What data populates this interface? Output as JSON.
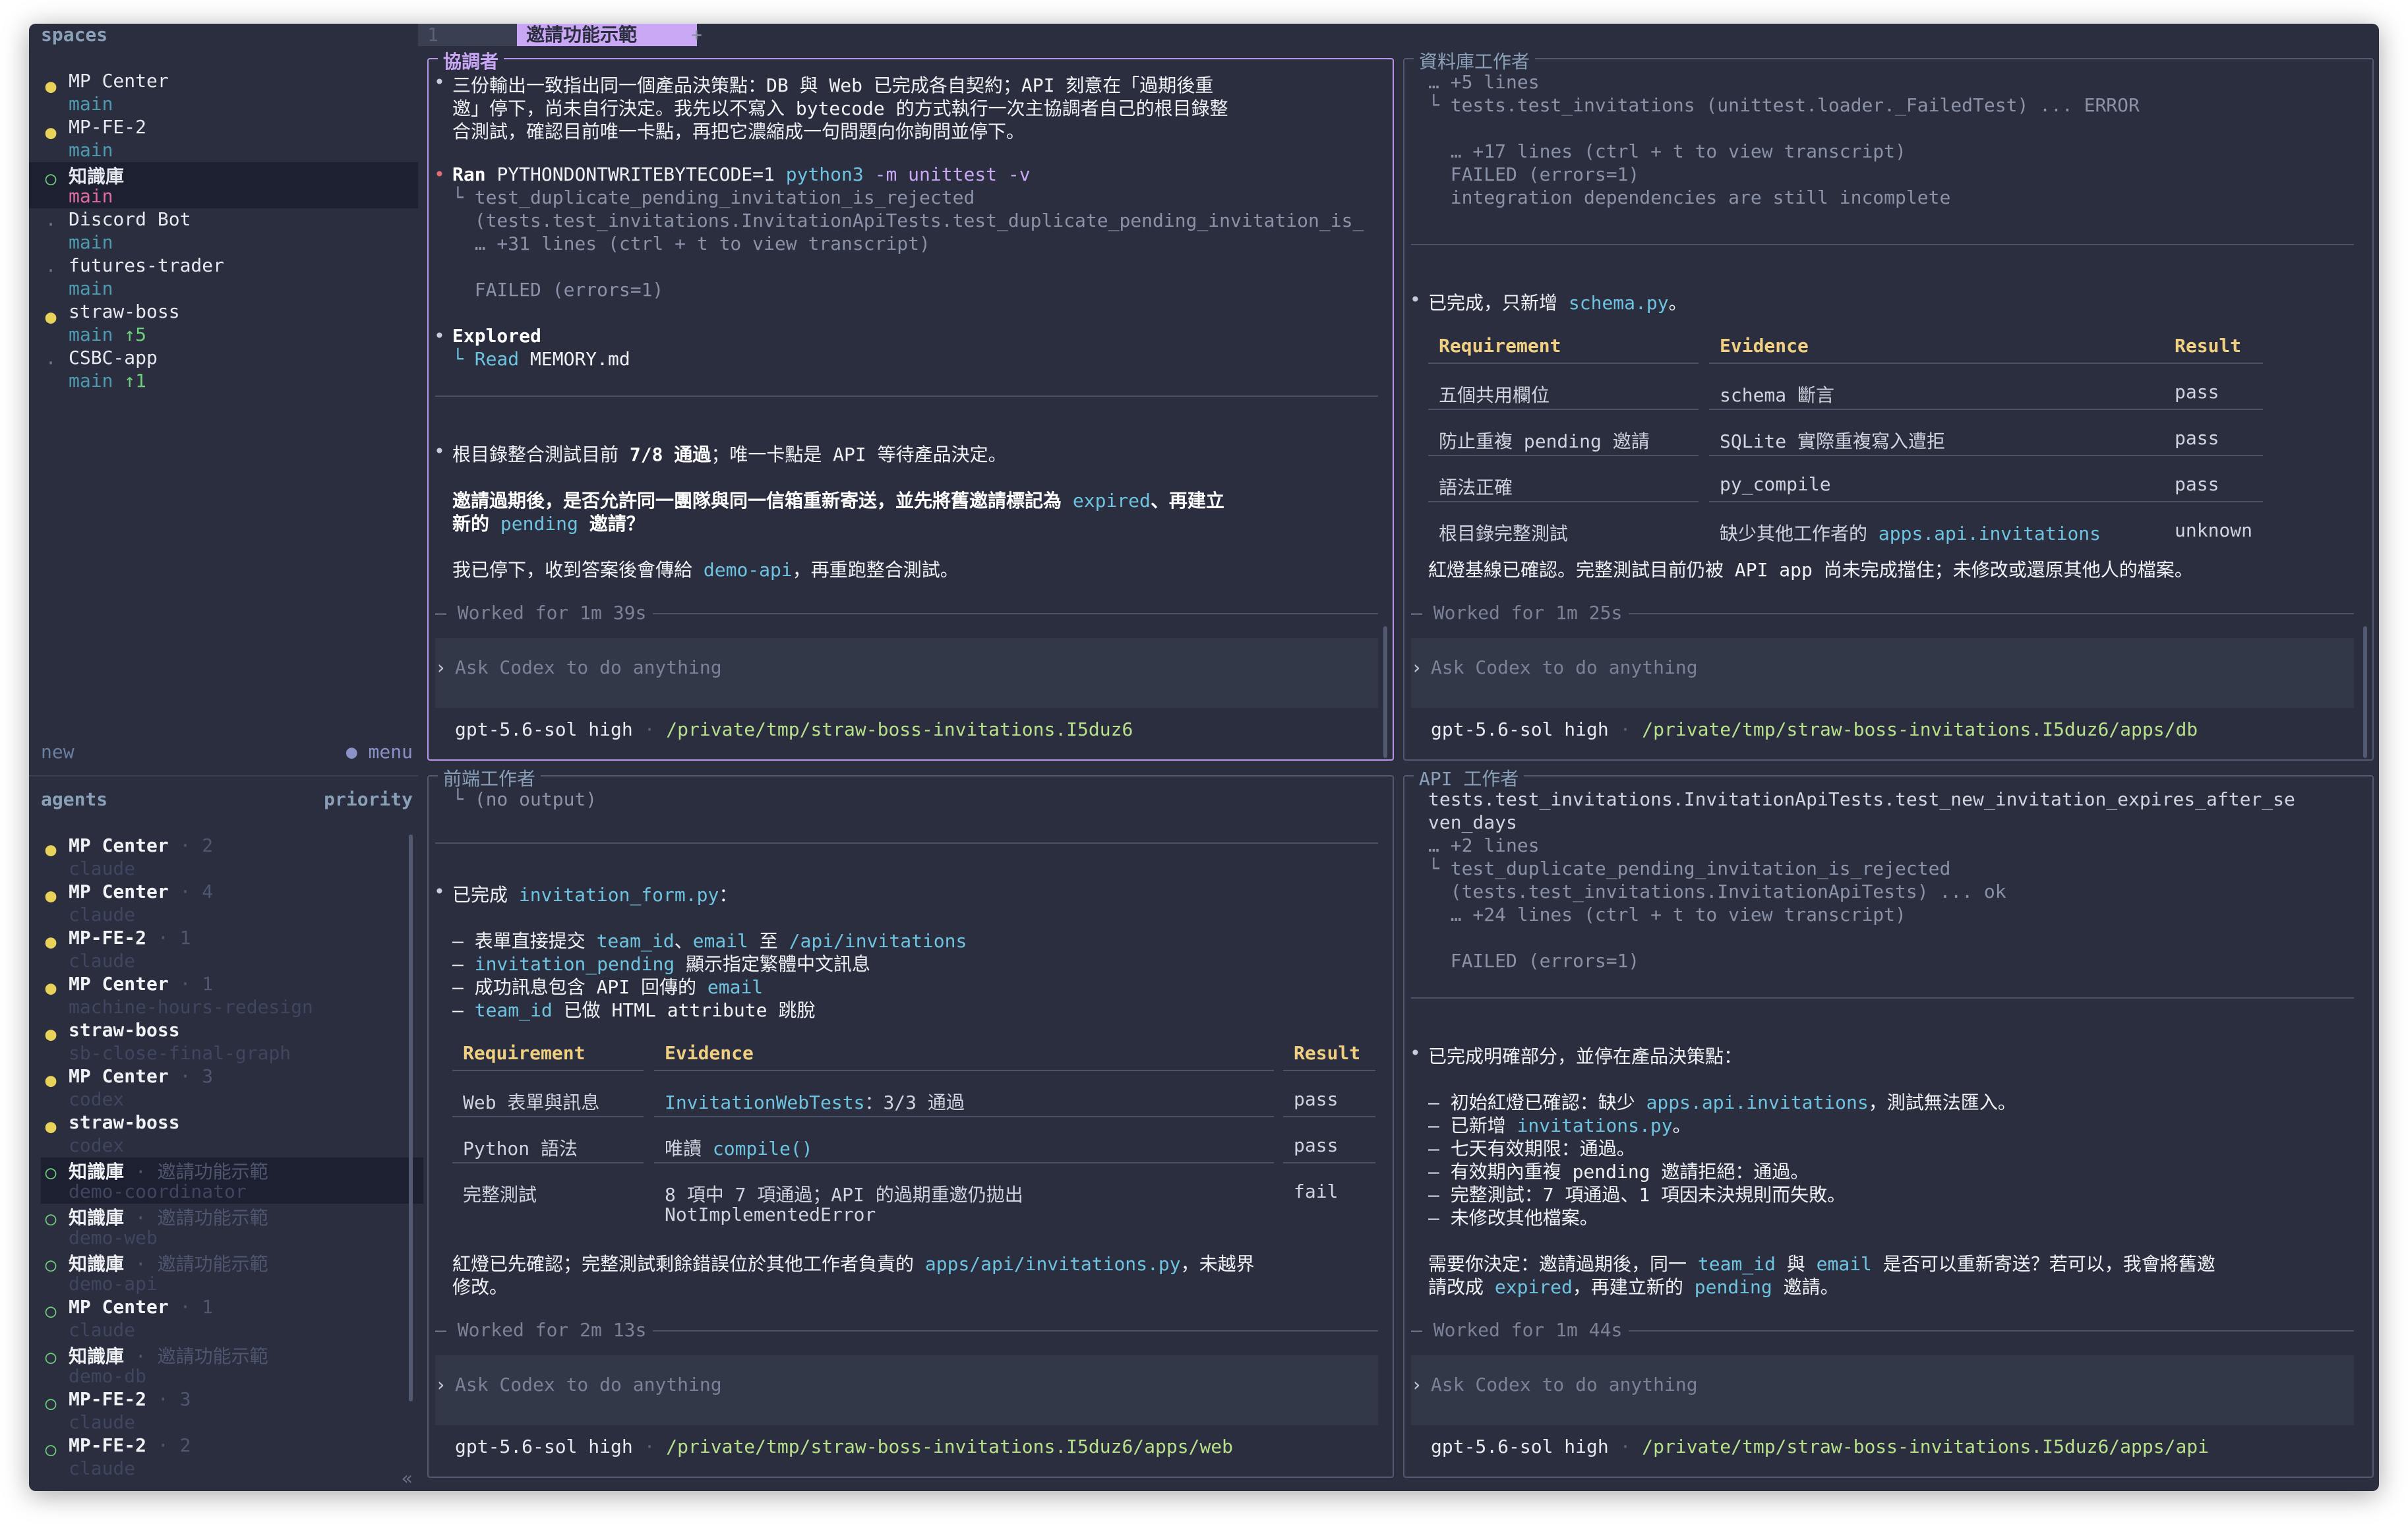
{
  "sidebar": {
    "spaces_label": "spaces",
    "spaces": [
      {
        "name": "MP Center",
        "branch": "main",
        "dot": "●",
        "dot_color": "yellow"
      },
      {
        "name": "MP-FE-2",
        "branch": "main",
        "dot": "●",
        "dot_color": "yellow"
      },
      {
        "name": "知識庫",
        "branch": "main",
        "dot": "○",
        "dot_color": "green",
        "selected": true
      },
      {
        "name": "Discord Bot",
        "branch": "main",
        "dot": "·",
        "dot_color": "grey"
      },
      {
        "name": "futures-trader",
        "branch": "main",
        "dot": "·",
        "dot_color": "grey"
      },
      {
        "name": "straw-boss",
        "branch": "main",
        "branch_extra": "↑5",
        "dot": "●",
        "dot_color": "yellow"
      },
      {
        "name": "CSBC-app",
        "branch": "main",
        "branch_extra": "↑1",
        "dot": "·",
        "dot_color": "grey"
      }
    ],
    "new_label": "new",
    "menu_label": "● menu",
    "agents_label": "agents",
    "priority_label": "priority",
    "collapse_label": "«",
    "agents": [
      {
        "name": "MP Center",
        "num": "· 2",
        "sub": "claude",
        "dot": "●",
        "dot_color": "yellow"
      },
      {
        "name": "MP Center",
        "num": "· 4",
        "sub": "claude",
        "dot": "●",
        "dot_color": "yellow"
      },
      {
        "name": "MP-FE-2",
        "num": "· 1",
        "sub": "claude",
        "dot": "●",
        "dot_color": "yellow"
      },
      {
        "name": "MP Center",
        "num": "· 1",
        "sub": "machine-hours-redesign",
        "dot": "●",
        "dot_color": "yellow"
      },
      {
        "name": "straw-boss",
        "num": "",
        "sub": "sb-close-final-graph",
        "dot": "●",
        "dot_color": "yellow"
      },
      {
        "name": "MP Center",
        "num": "· 3",
        "sub": "codex",
        "dot": "●",
        "dot_color": "yellow"
      },
      {
        "name": "straw-boss",
        "num": "",
        "sub": "codex",
        "dot": "●",
        "dot_color": "yellow"
      },
      {
        "name": "知識庫",
        "num": "· 邀請功能示範",
        "sub": "demo-coordinator",
        "dot": "○",
        "dot_color": "green",
        "selected": true
      },
      {
        "name": "知識庫",
        "num": "· 邀請功能示範",
        "sub": "demo-web",
        "dot": "○",
        "dot_color": "green"
      },
      {
        "name": "知識庫",
        "num": "· 邀請功能示範",
        "sub": "demo-api",
        "dot": "○",
        "dot_color": "green"
      },
      {
        "name": "MP Center",
        "num": "· 1",
        "sub": "claude",
        "dot": "○",
        "dot_color": "green"
      },
      {
        "name": "知識庫",
        "num": "· 邀請功能示範",
        "sub": "demo-db",
        "dot": "○",
        "dot_color": "green"
      },
      {
        "name": "MP-FE-2",
        "num": "· 3",
        "sub": "claude",
        "dot": "○",
        "dot_color": "green"
      },
      {
        "name": "MP-FE-2",
        "num": "· 2",
        "sub": "claude",
        "dot": "○",
        "dot_color": "green"
      }
    ]
  },
  "tabs": {
    "tab1": "1",
    "tab2": "邀請功能示範",
    "plus": "+"
  },
  "panes": {
    "coordinator": {
      "title": "協調者",
      "p1_l1": "三份輸出一致指出同一個產品決策點：DB 與 Web 已完成各自契約；API 刻意在「過期後重",
      "p1_l2": "邀」停下，尚未自行決定。我先以不寫入 bytecode 的方式執行一次主協調者自己的根目錄整",
      "p1_l3": "合測試，確認目前唯一卡點，再把它濃縮成一句問題向你詢問並停下。",
      "ran_label": "Ran",
      "ran_cmd": "PYTHONDONTWRITEBYTECODE=1",
      "ran_py": "python3",
      "ran_args": "-m unittest -v",
      "ran_o1": "└ test_duplicate_pending_invitation_is_rejected",
      "ran_o2": "  (tests.test_invitations.InvitationApiTests.test_duplicate_pending_invitation_is_",
      "ran_o3": "  … +31 lines (ctrl + t to view transcript)",
      "ran_o4": "  FAILED (errors=1)",
      "explored_label": "Explored",
      "explored_read": "└ Read",
      "explored_file": "MEMORY.md",
      "s_pre": "根目錄整合測試目前",
      "s_bold": "7/8 通過",
      "s_post": "；唯一卡點是 API 等待產品決定。",
      "q1a": "邀請過期後，是否允許同一團隊與同一信箱重新寄送，並先將舊邀請標記為",
      "q1b": "expired",
      "q1c": "、再建立",
      "q2a": "新的",
      "q2b": "pending",
      "q2c": "邀請？",
      "stop_a": "我已停下，收到答案後會傳給",
      "stop_b": "demo-api",
      "stop_c": "，再重跑整合測試。",
      "worked": "Worked for 1m 39s",
      "placeholder": "Ask Codex to do anything",
      "model": "gpt-5.6-sol high",
      "sep": "·",
      "path": "/private/tmp/straw-boss-invitations.I5duz6"
    },
    "db": {
      "title": "資料庫工作者",
      "l1": "… +5 lines",
      "l2": "└ tests.test_invitations (unittest.loader._FailedTest) ... ERROR",
      "l3": "  … +17 lines (ctrl + t to view transcript)",
      "l4": "  FAILED (errors=1)",
      "l5": "  integration dependencies are still incomplete",
      "done_a": "已完成，只新增",
      "done_b": "schema.py",
      "done_c": "。",
      "table_headers": [
        "Requirement",
        "Evidence",
        "Result"
      ],
      "rows": [
        {
          "req": "五個共用欄位",
          "ev": "schema 斷言",
          "res": "pass"
        },
        {
          "req": "防止重複 pending 邀請",
          "ev": "SQLite 實際重複寫入遭拒",
          "res": "pass"
        },
        {
          "req": "語法正確",
          "ev": "py_compile",
          "res": "pass"
        },
        {
          "req": "根目錄完整測試",
          "ev_a": "缺少其他工作者的",
          "ev_b": "apps.api.invitations",
          "res": "unknown"
        }
      ],
      "summary": "紅燈基線已確認。完整測試目前仍被 API app 尚未完成擋住；未修改或還原其他人的檔案。",
      "worked": "Worked for 1m 25s",
      "placeholder": "Ask Codex to do anything",
      "model": "gpt-5.6-sol high",
      "sep": "·",
      "path": "/private/tmp/straw-boss-invitations.I5duz6/apps/db"
    },
    "web": {
      "title": "前端工作者",
      "l0": "└ (no output)",
      "done_a": "已完成",
      "done_b": "invitation_form.py",
      "done_c": "：",
      "b1a": "– 表單直接提交",
      "b1b": "team_id",
      "b1c": "、",
      "b1d": "email",
      "b1e": "至",
      "b1f": "/api/invitations",
      "b2a": "– ",
      "b2b": "invitation_pending",
      "b2c": "顯示指定繁體中文訊息",
      "b3a": "– 成功訊息包含 API 回傳的",
      "b3b": "email",
      "b4a": "– ",
      "b4b": "team_id",
      "b4c": "已做 HTML attribute 跳脫",
      "table_headers": [
        "Requirement",
        "Evidence",
        "Result"
      ],
      "r1_req": "Web 表單與訊息",
      "r1_ev_a": "InvitationWebTests",
      "r1_ev_b": "：3/3 通過",
      "r1_res": "pass",
      "r2_req": "Python 語法",
      "r2_ev_a": "唯讀",
      "r2_ev_b": "compile()",
      "r2_res": "pass",
      "r3_req": "完整測試",
      "r3_ev_a": "8 項中 7 項通過；API 的過期重邀仍拋出",
      "r3_ev_b": "NotImplementedError",
      "r3_res": "fail",
      "sum_a": "紅燈已先確認；完整測試剩餘錯誤位於其他工作者負責的",
      "sum_b": "apps/api/invitations.py",
      "sum_c": "，未越界",
      "sum_d": "修改。",
      "worked": "Worked for 2m 13s",
      "placeholder": "Ask Codex to do anything",
      "model": "gpt-5.6-sol high",
      "sep": "·",
      "path": "/private/tmp/straw-boss-invitations.I5duz6/apps/web"
    },
    "api": {
      "title": "API 工作者",
      "l1": "tests.test_invitations.InvitationApiTests.test_new_invitation_expires_after_se",
      "l2": "ven_days",
      "l3": "… +2 lines",
      "l4": "└ test_duplicate_pending_invitation_is_rejected",
      "l5": "  (tests.test_invitations.InvitationApiTests) ... ok",
      "l6": "  … +24 lines (ctrl + t to view transcript)",
      "l7": "  FAILED (errors=1)",
      "done": "已完成明確部分，並停在產品決策點：",
      "b1a": "– 初始紅燈已確認：缺少",
      "b1b": "apps.api.invitations",
      "b1c": "，測試無法匯入。",
      "b2a": "– 已新增",
      "b2b": "invitations.py",
      "b2c": "。",
      "b3": "– 七天有效期限：通過。",
      "b4": "– 有效期內重複 pending 邀請拒絕：通過。",
      "b5": "– 完整測試：7 項通過、1 項因未決規則而失敗。",
      "b6": "– 未修改其他檔案。",
      "q1a": "需要你決定：邀請過期後，同一",
      "q1b": "team_id",
      "q1c": "與",
      "q1d": "email",
      "q1e": "是否可以重新寄送？若可以，我會將舊邀",
      "q2a": "請改成",
      "q2b": "expired",
      "q2c": "，再建立新的",
      "q2d": "pending",
      "q2e": "邀請。",
      "worked": "Worked for 1m 44s",
      "placeholder": "Ask Codex to do anything",
      "model": "gpt-5.6-sol high",
      "sep": "·",
      "path": "/private/tmp/straw-boss-invitations.I5duz6/apps/api"
    }
  },
  "colors": {
    "accent": "#c9a7f5",
    "background": "#2a2e3f",
    "yellow": "#e8d25a",
    "green": "#6fcf7a",
    "cyan": "#6ec3e0",
    "path": "#b8e08a",
    "table_header": "#f0d080",
    "error": "#e06c75"
  }
}
